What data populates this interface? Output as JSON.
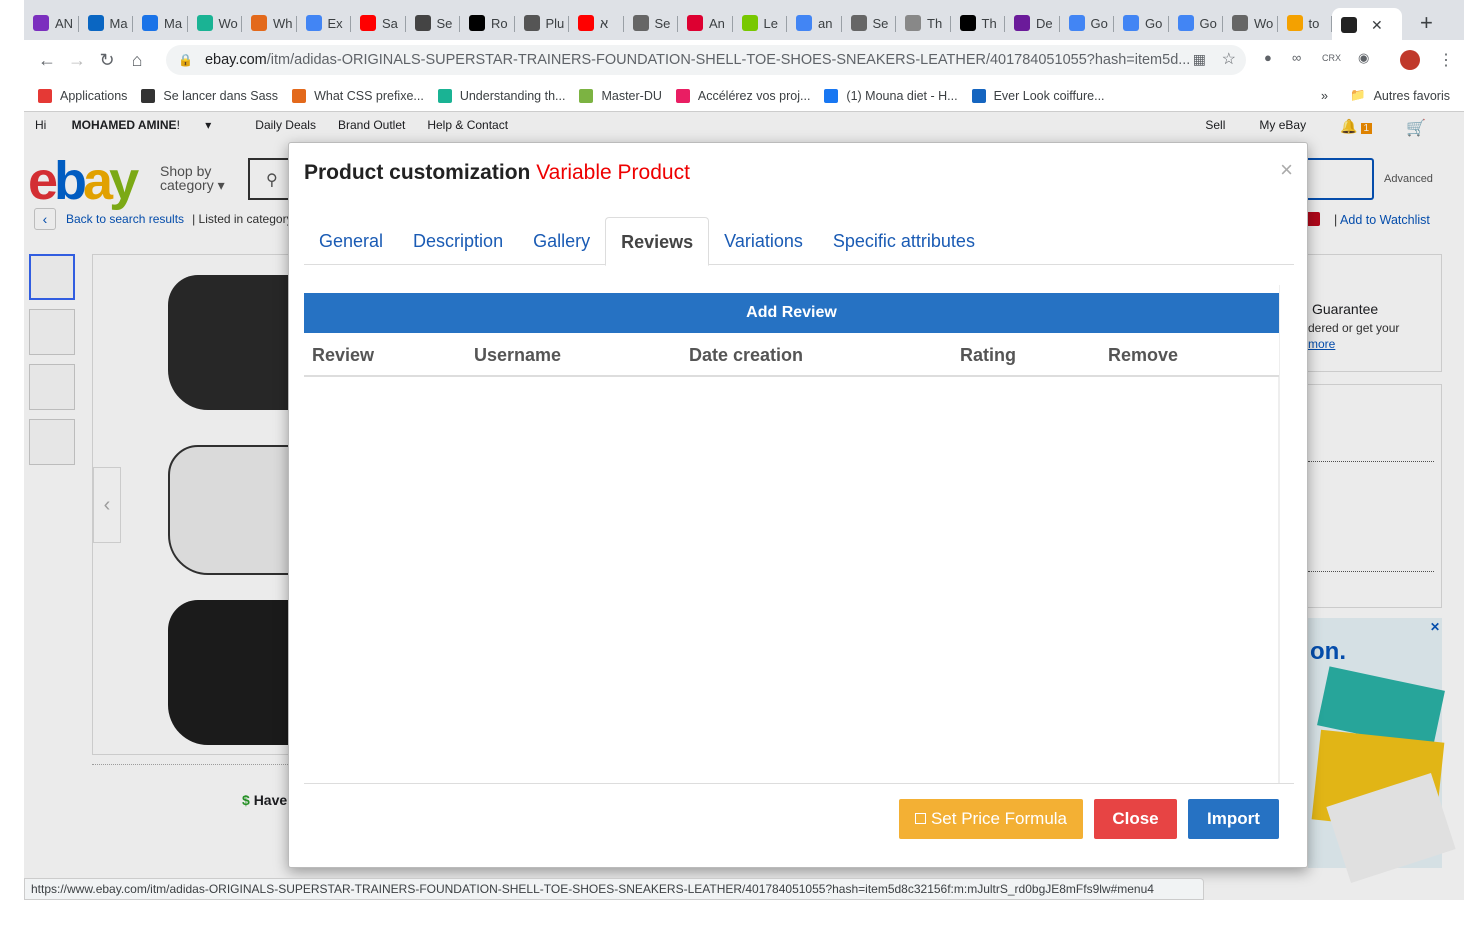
{
  "browser": {
    "tabs": [
      {
        "label": "AN",
        "color": "#7b2fbe",
        "icon": "onenote-icon"
      },
      {
        "label": "Ma",
        "color": "#0a66c2",
        "icon": "outlook-icon"
      },
      {
        "label": "Ma",
        "color": "#1a73e8",
        "icon": "site-icon"
      },
      {
        "label": "Wo",
        "color": "#1ab394",
        "icon": "hex-icon"
      },
      {
        "label": "Wh",
        "color": "#e3691b",
        "icon": "star-icon"
      },
      {
        "label": "Ex",
        "color": "#4285f4",
        "icon": "puzzle-icon"
      },
      {
        "label": "Sa",
        "color": "#ff0000",
        "icon": "youtube-icon"
      },
      {
        "label": "Se",
        "color": "#444",
        "icon": "doc-icon"
      },
      {
        "label": "Ro",
        "color": "#000",
        "icon": "angular-icon"
      },
      {
        "label": "Plu",
        "color": "#555",
        "icon": "globe-icon"
      },
      {
        "label": "⁧א⁩",
        "color": "#ff0000",
        "icon": "youtube-icon"
      },
      {
        "label": "Se",
        "color": "#666",
        "icon": "wordpress-icon"
      },
      {
        "label": "An",
        "color": "#dd0031",
        "icon": "angular-icon"
      },
      {
        "label": "Le",
        "color": "#78c800",
        "icon": "pencil-icon"
      },
      {
        "label": "an",
        "color": "#4285f4",
        "icon": "google-icon"
      },
      {
        "label": "Se",
        "color": "#666",
        "icon": "wordpress-icon"
      },
      {
        "label": "Th",
        "color": "#888",
        "icon": "site-icon"
      },
      {
        "label": "Th",
        "color": "#000",
        "icon": "medium-icon"
      },
      {
        "label": "De",
        "color": "#6b1b9a",
        "icon": "x-icon"
      },
      {
        "label": "Go",
        "color": "#4285f4",
        "icon": "google-icon"
      },
      {
        "label": "Go",
        "color": "#4285f4",
        "icon": "google-icon"
      },
      {
        "label": "Go",
        "color": "#4285f4",
        "icon": "google-icon"
      },
      {
        "label": "Wo",
        "color": "#666",
        "icon": "wordpress-icon"
      },
      {
        "label": "to",
        "color": "#f4a100",
        "icon": "stack-icon"
      },
      {
        "label": "",
        "color": "#222",
        "icon": "ebay-bag-icon",
        "active": true
      }
    ],
    "url_host": "ebay.com",
    "url_path": "/itm/adidas-ORIGINALS-SUPERSTAR-TRAINERS-FOUNDATION-SHELL-TOE-SHOES-SNEAKERS-LEATHER/401784051055?hash=item5d...",
    "bookmarks": [
      {
        "label": "Applications",
        "color": "#e53935"
      },
      {
        "label": "Se lancer dans Sass",
        "color": "#333"
      },
      {
        "label": "What CSS prefixe...",
        "color": "#e3691b"
      },
      {
        "label": "Understanding th...",
        "color": "#1ab394"
      },
      {
        "label": "Master-DU",
        "color": "#7cb342"
      },
      {
        "label": "Accélérez vos proj...",
        "color": "#e91e63"
      },
      {
        "label": "(1) Mouna diet - H...",
        "color": "#1877f2"
      },
      {
        "label": "Ever Look coiffure...",
        "color": "#1565c0"
      }
    ],
    "other_bookmarks": "Autres favoris",
    "status_url": "https://www.ebay.com/itm/adidas-ORIGINALS-SUPERSTAR-TRAINERS-FOUNDATION-SHELL-TOE-SHOES-SNEAKERS-LEATHER/401784051055?hash=item5d8c32156f:m:mJultrS_rd0bgJE8mFfs9lw#menu4"
  },
  "ebay": {
    "greeting_prefix": "Hi ",
    "greeting_name": "MOHAMED AMINE",
    "greeting_suffix": "!",
    "top_links": [
      "Daily Deals",
      "Brand Outlet",
      "Help & Contact"
    ],
    "sell": "Sell",
    "my_ebay": "My eBay",
    "notif_count": "1",
    "shop_by": "Shop by",
    "category": "category",
    "back": "Back to search results",
    "listed": "| Listed in category:",
    "advanced": "Advanced",
    "watchlist": "Add to Watchlist",
    "guarantee": "Guarantee",
    "guarantee_sub": "dered or get your",
    "guarantee_more": "more",
    "have": "Have",
    "ad_title": "on.",
    "logo_letters": [
      "e",
      "b",
      "a",
      "y"
    ]
  },
  "modal": {
    "title": "Product customization",
    "subtitle": "Variable Product",
    "close_x": "×",
    "tabs": [
      "General",
      "Description",
      "Gallery",
      "Reviews",
      "Variations",
      "Specific attributes"
    ],
    "active_tab": "Reviews",
    "add_review": "Add Review",
    "columns": [
      "Review",
      "Username",
      "Date creation",
      "Rating",
      "Remove"
    ],
    "set_price_formula": "Set Price Formula",
    "close": "Close",
    "import": "Import"
  }
}
